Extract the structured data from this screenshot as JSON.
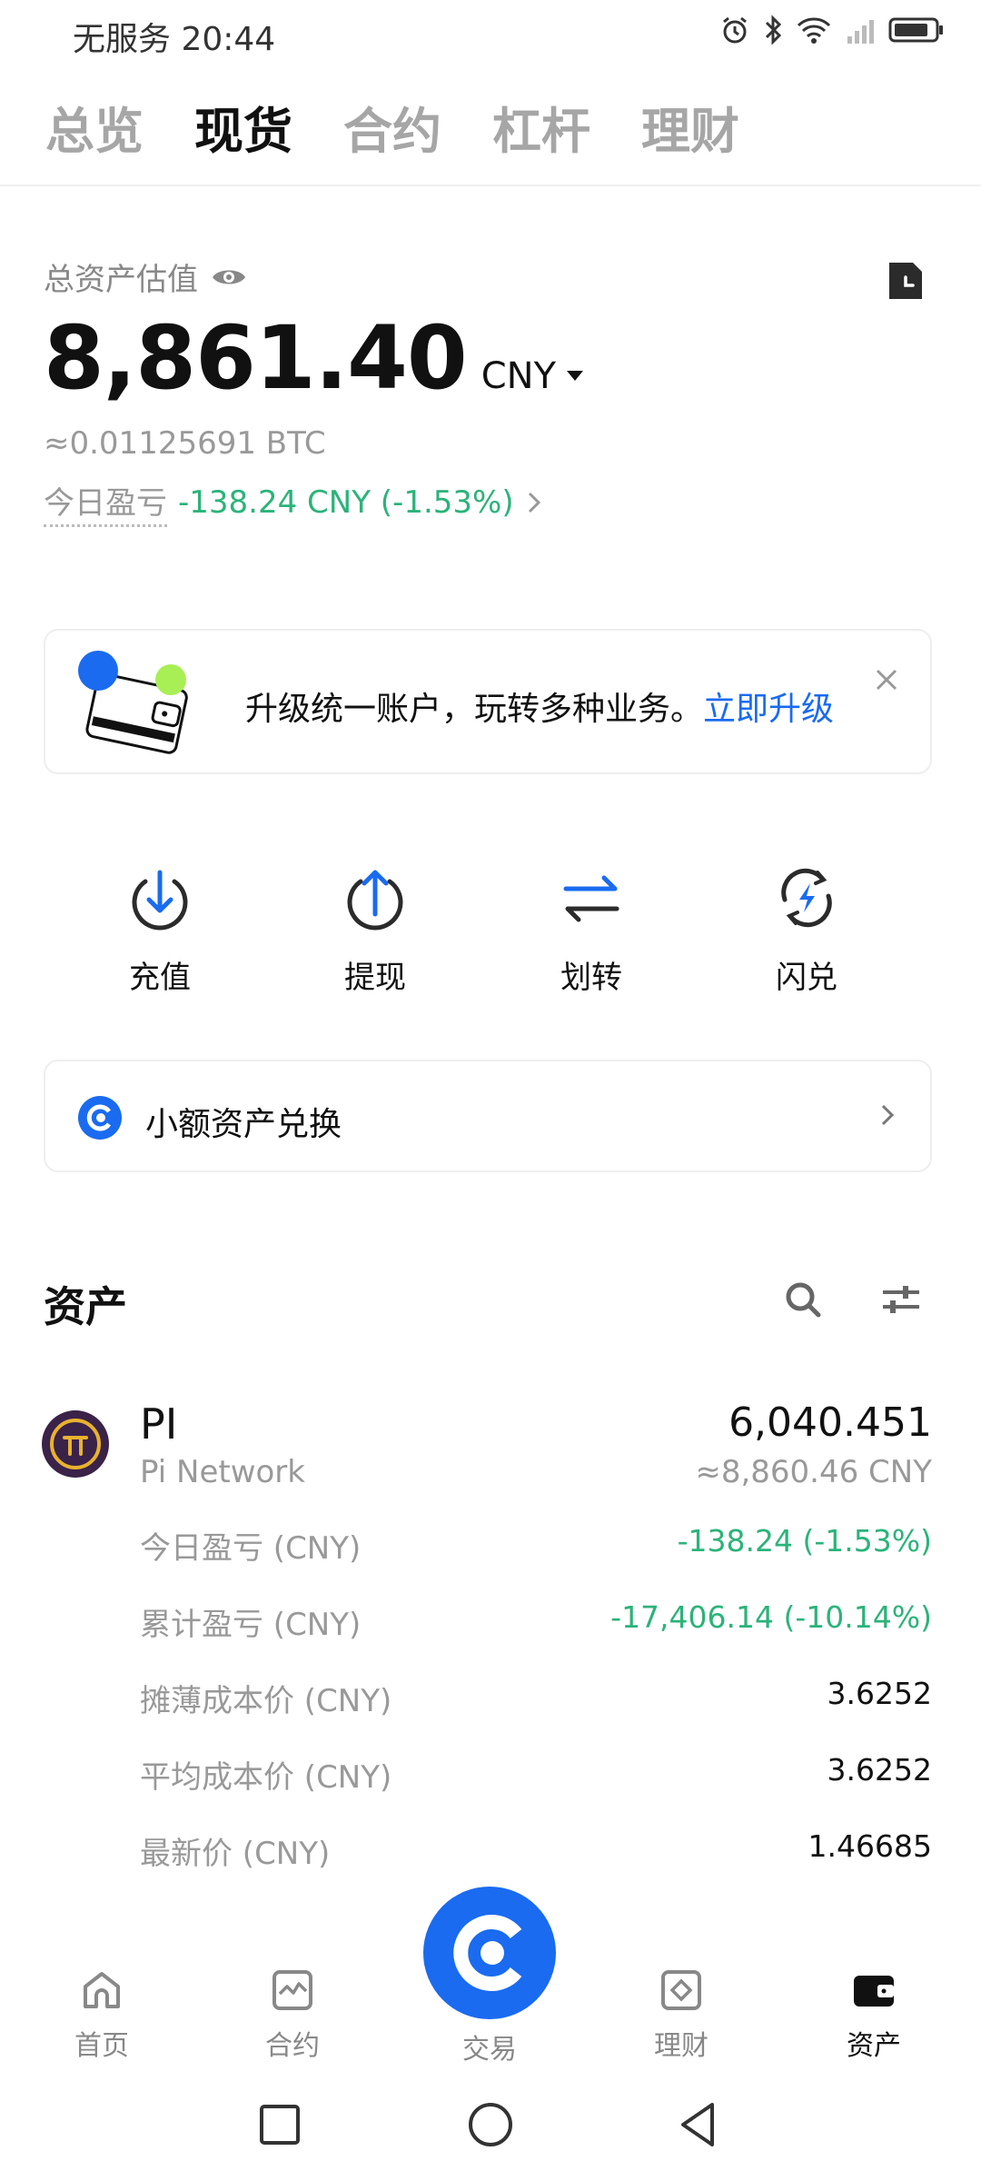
{
  "status_bar": {
    "carrier_time": "无服务 20:44",
    "icons": [
      "alarm-icon",
      "bluetooth-icon",
      "wifi-icon",
      "signal-icon",
      "battery-icon"
    ]
  },
  "top_tabs": [
    {
      "label": "总览",
      "active": false
    },
    {
      "label": "现货",
      "active": true
    },
    {
      "label": "合约",
      "active": false
    },
    {
      "label": "杠杆",
      "active": false
    },
    {
      "label": "理财",
      "active": false
    }
  ],
  "summary": {
    "label": "总资产估值",
    "total": "8,861.40",
    "currency": "CNY",
    "btc_equiv": "≈0.01125691 BTC",
    "pnl_label": "今日盈亏",
    "pnl_value": "-138.24 CNY (-1.53%)"
  },
  "banner": {
    "text": "升级统一账户，玩转多种业务。",
    "link": "立即升级"
  },
  "actions": [
    {
      "label": "充值",
      "icon": "deposit-icon"
    },
    {
      "label": "提现",
      "icon": "withdraw-icon"
    },
    {
      "label": "划转",
      "icon": "transfer-icon"
    },
    {
      "label": "闪兑",
      "icon": "flash-convert-icon"
    }
  ],
  "dust": {
    "label": "小额资产兑换"
  },
  "assets_section": {
    "title": "资产"
  },
  "asset": {
    "symbol": "PI",
    "name": "Pi Network",
    "amount": "6,040.451",
    "amount_cny": "≈8,860.46 CNY",
    "details": [
      {
        "label": "今日盈亏 (CNY)",
        "value": "-138.24 (-1.53%)",
        "green": true
      },
      {
        "label": "累计盈亏 (CNY)",
        "value": "-17,406.14 (-10.14%)",
        "green": true
      },
      {
        "label": "摊薄成本价 (CNY)",
        "value": "3.6252",
        "green": false
      },
      {
        "label": "平均成本价 (CNY)",
        "value": "3.6252",
        "green": false
      },
      {
        "label": "最新价 (CNY)",
        "value": "1.46685",
        "green": false
      }
    ]
  },
  "bottom_nav": [
    {
      "label": "首页",
      "icon": "home-icon",
      "active": false
    },
    {
      "label": "合约",
      "icon": "futures-icon",
      "active": false
    },
    {
      "label": "交易",
      "icon": "trade-icon",
      "active": false
    },
    {
      "label": "理财",
      "icon": "earn-icon",
      "active": false
    },
    {
      "label": "资产",
      "icon": "wallet-icon",
      "active": true
    }
  ],
  "colors": {
    "accent": "#1a6bf0",
    "positive_green": "#2bb37a",
    "muted": "#999999"
  }
}
